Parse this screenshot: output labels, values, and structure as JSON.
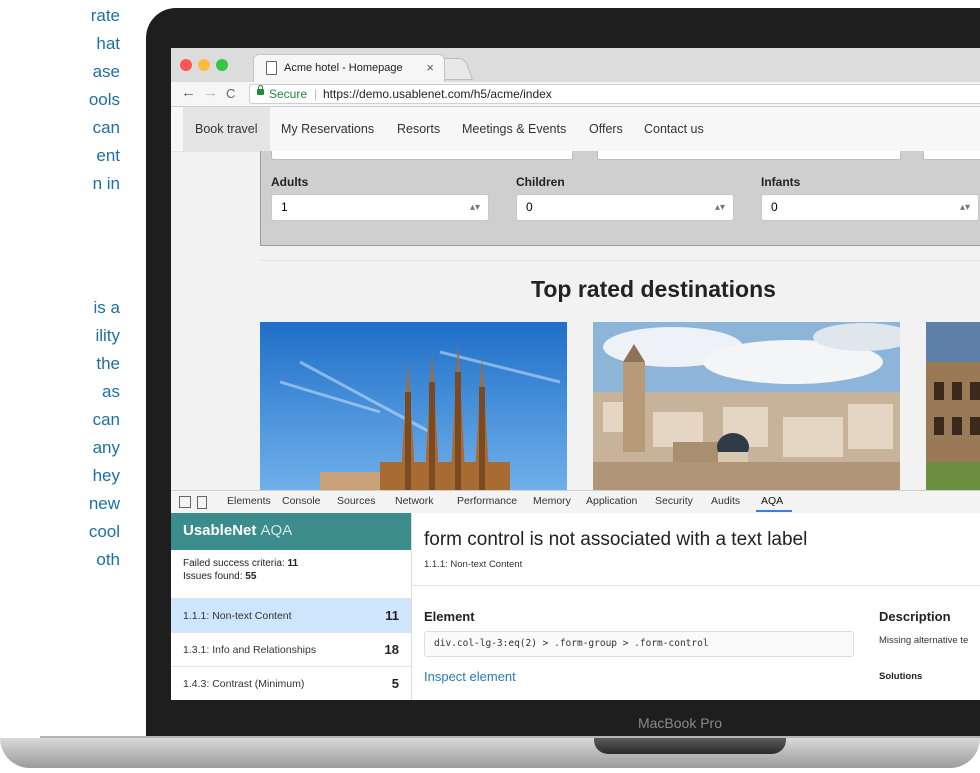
{
  "side_text": [
    "rate",
    "hat",
    "ase",
    "ools",
    "can",
    "ent",
    "n  in",
    "is a",
    "ility",
    "the",
    "as",
    "can",
    "any",
    "hey",
    "new",
    "cool",
    "oth"
  ],
  "colors": {
    "accent_text": "#1d6fa5",
    "aqa_brand": "#3d8c8c",
    "secure_green": "#1e8a3a",
    "selected_row": "#cde6fb"
  },
  "laptop_label": "MacBook Pro",
  "browser": {
    "tab_title": "Acme hotel - Homepage",
    "tab_close": "×",
    "back": "←",
    "forward": "→",
    "reload": "C",
    "secure_label": "Secure",
    "url_separator": "|",
    "url": "https://demo.usablenet.com/h5/acme/index"
  },
  "site": {
    "nav": [
      "Book travel",
      "My Reservations",
      "Resorts",
      "Meetings & Events",
      "Offers",
      "Contact us"
    ],
    "fields": [
      {
        "label": "Adults",
        "value": "1"
      },
      {
        "label": "Children",
        "value": "0"
      },
      {
        "label": "Infants",
        "value": "0"
      }
    ],
    "select_arrow": "▴▾",
    "section_title": "Top rated destinations"
  },
  "devtools": {
    "tabs": [
      "Elements",
      "Console",
      "Sources",
      "Network",
      "Performance",
      "Memory",
      "Application",
      "Security",
      "Audits",
      "AQA"
    ],
    "active_tab": "AQA"
  },
  "aqa": {
    "brand": "UsableNet",
    "brand_suffix": "AQA",
    "failed_label": "Failed success criteria:",
    "failed_value": "11",
    "issues_label": "Issues found:",
    "issues_value": "55",
    "criteria": [
      {
        "label": "1.1.1: Non-text Content",
        "count": "11",
        "selected": true
      },
      {
        "label": "1.3.1: Info and Relationships",
        "count": "18",
        "selected": false
      },
      {
        "label": "1.4.3: Contrast (Minimum)",
        "count": "5",
        "selected": false
      }
    ],
    "issue_title": "form control is not associated with a text label",
    "issue_criterion": "1.1.1: Non-text Content",
    "element_heading": "Element",
    "selector": "div.col-lg-3:eq(2) > .form-group > .form-control",
    "inspect_link": "Inspect element",
    "description_heading": "Description",
    "description_text": "Missing alternative te",
    "solutions_heading": "Solutions"
  }
}
